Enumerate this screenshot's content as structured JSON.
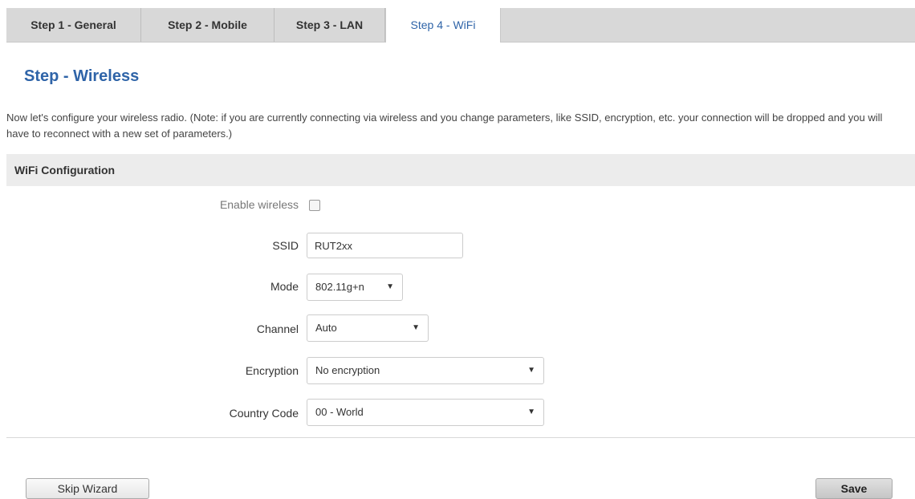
{
  "tabs": [
    {
      "label": "Step 1 - General",
      "active": false
    },
    {
      "label": "Step 2 - Mobile",
      "active": false
    },
    {
      "label": "Step 3 - LAN",
      "active": false
    },
    {
      "label": "Step 4 - WiFi",
      "active": true
    }
  ],
  "page": {
    "title": "Step - Wireless",
    "description": "Now let's configure your wireless radio. (Note: if you are currently connecting via wireless and you change parameters, like SSID, encryption, etc. your connection will be dropped and you will have to reconnect with a new set of parameters.)"
  },
  "section": {
    "title": "WiFi Configuration"
  },
  "form": {
    "enable_wireless": {
      "label": "Enable wireless",
      "checked": false
    },
    "ssid": {
      "label": "SSID",
      "value": "RUT2xx"
    },
    "mode": {
      "label": "Mode",
      "value": "802.11g+n"
    },
    "channel": {
      "label": "Channel",
      "value": "Auto"
    },
    "encryption": {
      "label": "Encryption",
      "value": "No encryption"
    },
    "country_code": {
      "label": "Country Code",
      "value": "00 - World"
    }
  },
  "icons": {
    "dropdown": "chevron-down-icon",
    "glyph": "▼"
  },
  "buttons": {
    "skip": "Skip Wizard",
    "save": "Save"
  },
  "colors": {
    "accent": "#2f64a8",
    "tabbar": "#d8d8d8",
    "section_bg": "#ececec"
  }
}
